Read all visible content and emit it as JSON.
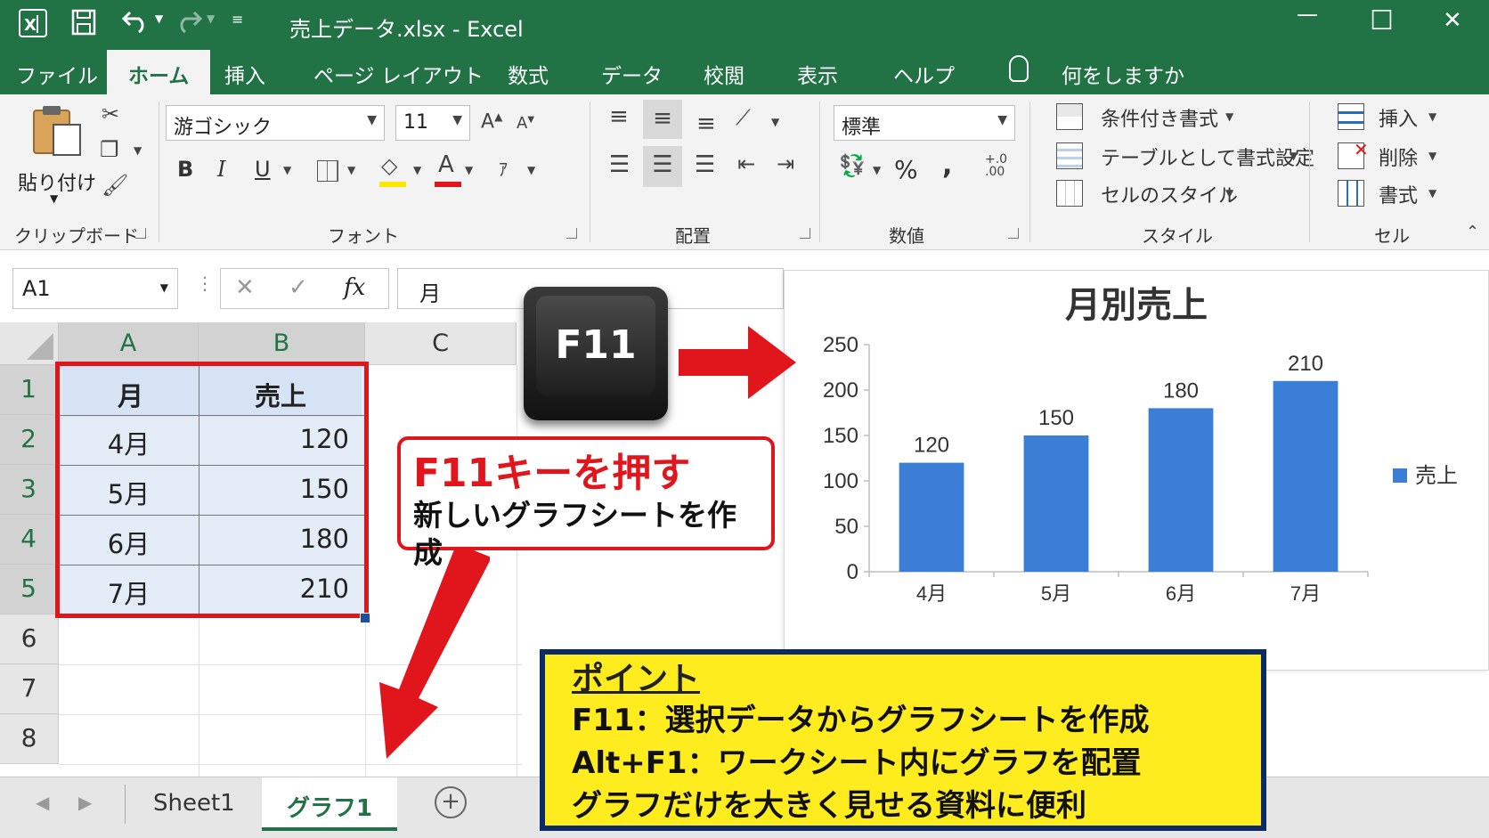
{
  "titlebar": {
    "title": "売上データ.xlsx  -  Excel",
    "minimize": "—",
    "maximize": "☐",
    "close": "✕"
  },
  "tabs": [
    {
      "label": "ファイル"
    },
    {
      "label": "ホーム"
    },
    {
      "label": "挿入"
    },
    {
      "label": "ページ レイアウト"
    },
    {
      "label": "数式"
    },
    {
      "label": "データ"
    },
    {
      "label": "校閲"
    },
    {
      "label": "表示"
    },
    {
      "label": "ヘルプ"
    }
  ],
  "tellme": "何をしますか",
  "ribbon": {
    "clipboard": {
      "paste": "貼り付け",
      "label": "クリップボード"
    },
    "font": {
      "name": "游ゴシック",
      "size": "11",
      "label": "フォント",
      "bold": "B",
      "italic": "I",
      "underline": "U"
    },
    "alignment": {
      "label": "配置"
    },
    "number": {
      "format": "標準",
      "label": "数値",
      "percent": "%",
      "comma": ","
    },
    "styles": {
      "conditional": "条件付き書式",
      "table": "テーブルとして書式設定",
      "cell_styles": "セルのスタイル",
      "label": "スタイル"
    },
    "cells": {
      "insert": "挿入",
      "delete": "削除",
      "format": "書式",
      "label": "セル"
    }
  },
  "formula_bar": {
    "name_box": "A1",
    "fx": "fx",
    "cancel": "✕",
    "enter": "✓",
    "content": "月"
  },
  "grid": {
    "columns": [
      "A",
      "B",
      "C"
    ],
    "rows": [
      "1",
      "2",
      "3",
      "4",
      "5",
      "6",
      "7",
      "8"
    ],
    "table": [
      [
        "月",
        "売上"
      ],
      [
        "4月",
        "120"
      ],
      [
        "5月",
        "150"
      ],
      [
        "6月",
        "180"
      ],
      [
        "7月",
        "210"
      ]
    ]
  },
  "sheet_tabs": [
    {
      "label": "Sheet1"
    },
    {
      "label": "グラフ1"
    }
  ],
  "key_label": "F11",
  "callout": {
    "line1": "F11キーを押す",
    "line2": "新しいグラフシートを作成"
  },
  "point": {
    "title": "ポイント",
    "lines": [
      "F11：選択データからグラフシートを作成",
      "Alt+F1：ワークシート内にグラフを配置",
      "グラフだけを大きく見せる資料に便利"
    ]
  },
  "colors": {
    "excel_green": "#217346",
    "bar": "#3a7fd5",
    "accent_red": "#e0161c",
    "point_yellow": "#ffec1f",
    "point_border": "#0b2a66"
  },
  "chart_data": {
    "type": "bar",
    "title": "月別売上",
    "categories": [
      "4月",
      "5月",
      "6月",
      "7月"
    ],
    "series": [
      {
        "name": "売上",
        "values": [
          120,
          150,
          180,
          210
        ]
      }
    ],
    "ylim": [
      0,
      250
    ],
    "yticks": [
      0,
      50,
      100,
      150,
      200,
      250
    ],
    "legend": "right",
    "grid": false
  }
}
